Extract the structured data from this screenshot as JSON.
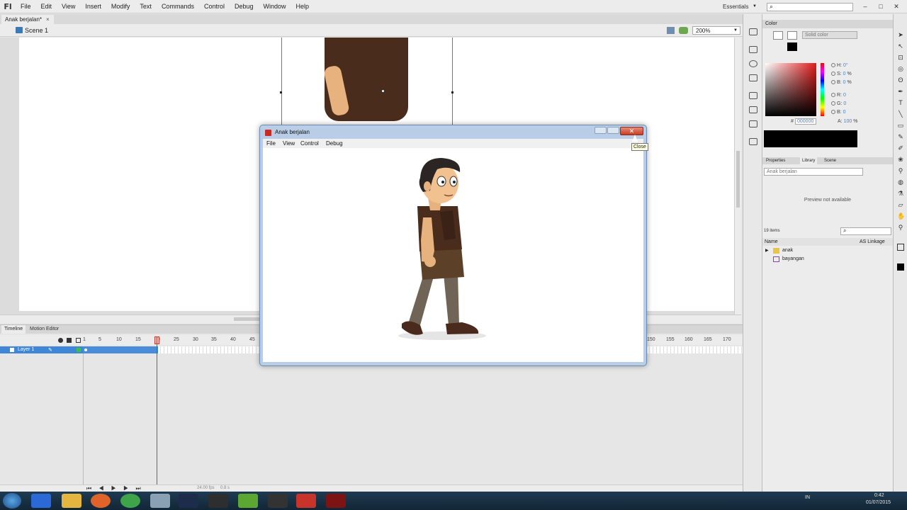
{
  "app": {
    "logo": "Fl",
    "menu": [
      "File",
      "Edit",
      "View",
      "Insert",
      "Modify",
      "Text",
      "Commands",
      "Control",
      "Debug",
      "Window",
      "Help"
    ],
    "workspace": "Essentials",
    "search_icon": "search-icon",
    "window_controls": [
      "–",
      "□",
      "✕"
    ]
  },
  "document": {
    "tab": "Anak berjalan*",
    "tab_close": "×",
    "scene": "Scene 1",
    "zoom": "200%"
  },
  "timeline": {
    "tabs": [
      "Timeline",
      "Motion Editor"
    ],
    "layer_name": "Layer 1",
    "frame_numbers": [
      "1",
      "5",
      "10",
      "15",
      "20",
      "25",
      "30",
      "35",
      "40",
      "45",
      "150",
      "155",
      "160",
      "165",
      "170"
    ],
    "current_frame": 20,
    "fps": "24.00 fps",
    "elapsed": "0.8 s",
    "controls": "⏮ ◀ ▶ ▶ ⏭"
  },
  "color_panel": {
    "title": "Color",
    "fill_type": "Solid color",
    "hsb": [
      {
        "label": "H:",
        "value": "0",
        "unit": "°"
      },
      {
        "label": "S:",
        "value": "0",
        "unit": "%"
      },
      {
        "label": "B:",
        "value": "0",
        "unit": "%"
      }
    ],
    "rgb": [
      {
        "label": "R:",
        "value": "0"
      },
      {
        "label": "G:",
        "value": "0"
      },
      {
        "label": "B:",
        "value": "0"
      }
    ],
    "hex_prefix": "#",
    "hex": "000000",
    "alpha_label": "A:",
    "alpha": "100",
    "alpha_unit": "%"
  },
  "library_panel": {
    "tabs": [
      "Properties",
      "Library",
      "Scene"
    ],
    "document": "Anak berjalan",
    "preview_text": "Preview not available",
    "item_count": "19 items",
    "col_name": "Name",
    "col_linkage": "AS Linkage",
    "items": [
      {
        "name": "anak",
        "type": "folder"
      },
      {
        "name": "bayangan",
        "type": "symbol"
      }
    ]
  },
  "player": {
    "title": "Anak berjalan",
    "menu": [
      "File",
      "View",
      "Control",
      "Debug"
    ],
    "close_symbol": "✕",
    "tooltip": "Close"
  },
  "taskbar": {
    "language": "IN",
    "time": "0:42",
    "date": "01/07/2015"
  },
  "colors": {
    "accent": "#3f86d6",
    "playhead": "#e0352b",
    "close_button": "#c73e22"
  }
}
